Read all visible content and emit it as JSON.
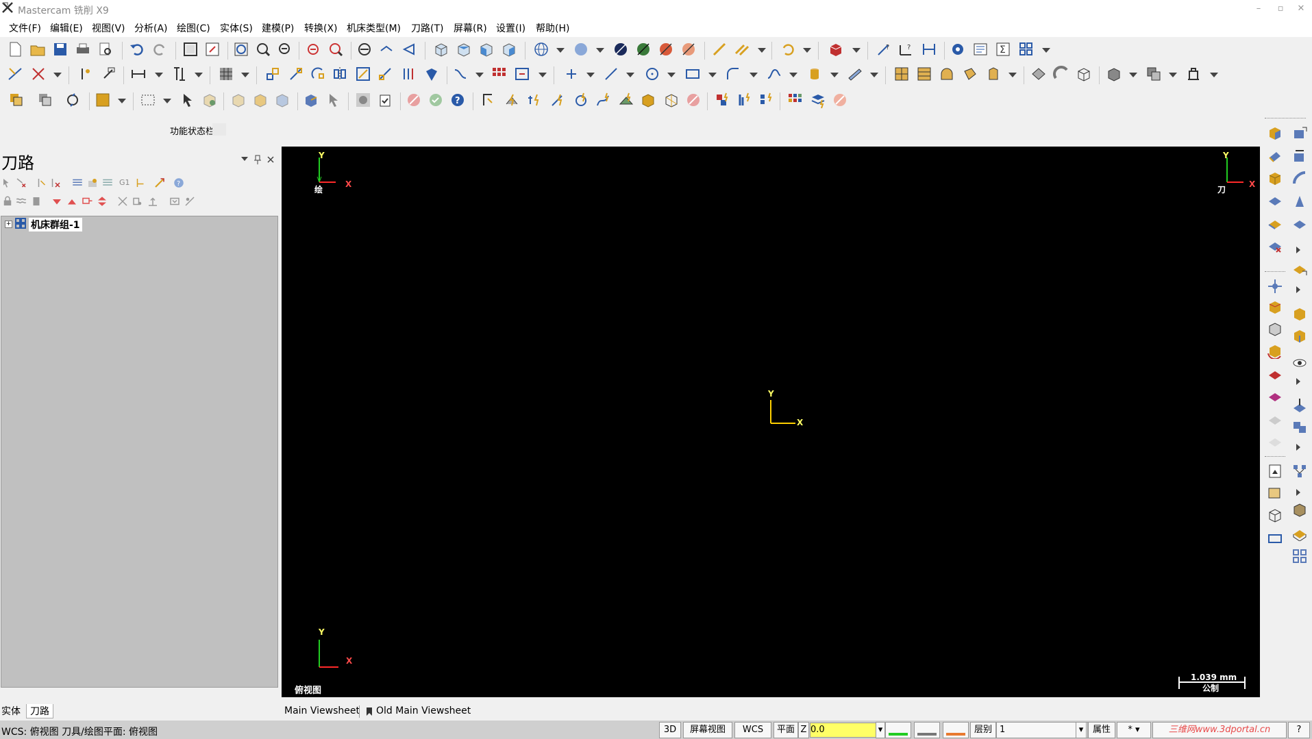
{
  "app": {
    "title": "Mastercam 铣削 X9",
    "window_min": "–",
    "window_max": "▫",
    "window_close": "✕"
  },
  "menu": [
    "文件(F)",
    "编辑(E)",
    "视图(V)",
    "分析(A)",
    "绘图(C)",
    "实体(S)",
    "建模(P)",
    "转换(X)",
    "机床类型(M)",
    "刀路(T)",
    "屏幕(R)",
    "设置(I)",
    "帮助(H)"
  ],
  "toolbar": {
    "status_bar_label": "功能状态栏"
  },
  "panel": {
    "title": "刀路",
    "tree_item": "机床群组-1",
    "tabs": [
      "实体",
      "刀路"
    ]
  },
  "viewport": {
    "top_left_label": "绘",
    "top_right_label": "刀",
    "axis_x": "X",
    "axis_y": "Y",
    "view_name": "俯视图",
    "scale_value": "1.039 mm",
    "scale_unit": "公制",
    "background": "#000000"
  },
  "viewsheets": [
    "Main Viewsheet",
    "Old Main Viewsheet"
  ],
  "statusbar": {
    "text": "WCS: 俯视图  刀具/绘图平面: 俯视图",
    "mode_3d": "3D",
    "screen_view": "屏幕视图",
    "wcs": "WCS",
    "plane": "平面",
    "z_label": "Z",
    "z_value": "0.0",
    "level_label": "层别",
    "level_value": "1",
    "attr_label": "属性",
    "watermark": "三维网www.3dportal.cn"
  },
  "colors": {
    "axis_x": "#ff2a2a",
    "axis_y": "#22cc22",
    "origin": "#ffd000",
    "z_field": "#ffff66"
  }
}
